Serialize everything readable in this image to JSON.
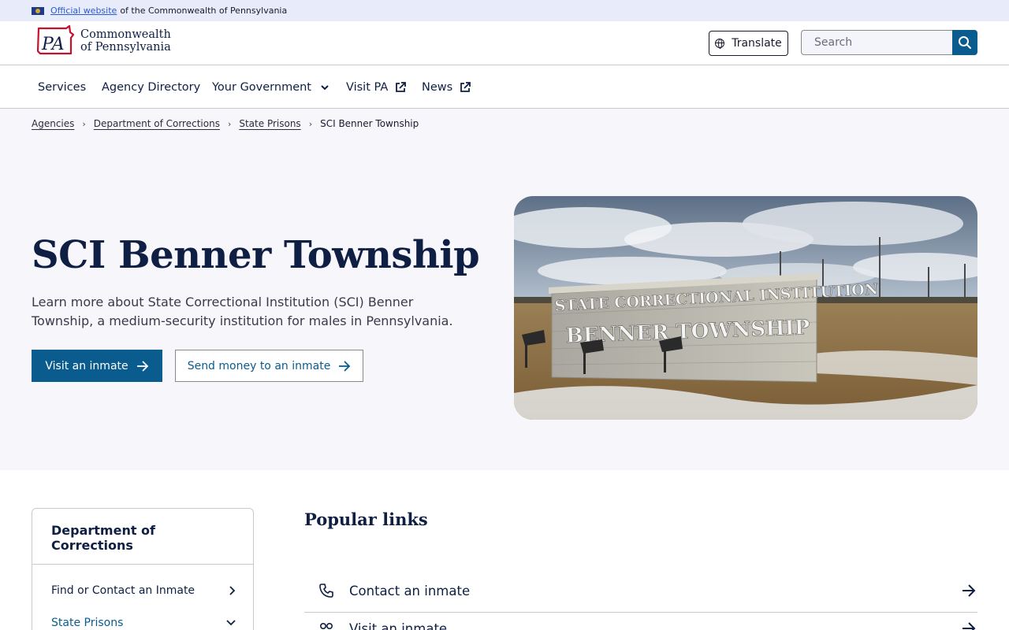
{
  "banner": {
    "link_text": "Official website",
    "suffix": "of the Commonwealth of Pennsylvania"
  },
  "header": {
    "logo_mark": "PA",
    "logo_line1": "Commonwealth",
    "logo_line2": "of Pennsylvania",
    "translate_label": "Translate",
    "search_placeholder": "Search",
    "colors": {
      "brand_red": "#c8102e",
      "accent_blue": "#0a5c8f",
      "navy": "#0f1f44"
    }
  },
  "nav": {
    "items": [
      {
        "label": "Services",
        "icon": ""
      },
      {
        "label": "Agency Directory",
        "icon": ""
      },
      {
        "label": "Your Government",
        "icon": "chevron-down-icon"
      },
      {
        "label": "Visit PA",
        "icon": "external-link-icon"
      },
      {
        "label": "News",
        "icon": "external-link-icon"
      }
    ]
  },
  "breadcrumb": {
    "items": [
      "Agencies",
      "Department of Corrections",
      "State Prisons"
    ],
    "current": "SCI Benner Township"
  },
  "hero": {
    "title": "SCI Benner Township",
    "description": "Learn more about State Correctional Institution (SCI) Benner Township, a medium-security institution for males in Pennsylvania.",
    "primary_button": "Visit an inmate",
    "secondary_button": "Send money to an inmate",
    "image": {
      "sign_line1": "STATE CORRECTIONAL INSTITUTION",
      "sign_line2": "BENNER TOWNSHIP"
    }
  },
  "sidebar": {
    "title": "Department of Corrections",
    "items": [
      {
        "label": "Find or Contact an Inmate",
        "icon": "chevron-right-icon"
      },
      {
        "label": "State Prisons",
        "icon": "chevron-down-icon"
      }
    ]
  },
  "popular": {
    "title": "Popular links",
    "links": [
      {
        "label": "Contact an inmate",
        "icon": "phone-icon"
      },
      {
        "label": "Visit an inmate",
        "icon": "people-icon"
      }
    ]
  }
}
